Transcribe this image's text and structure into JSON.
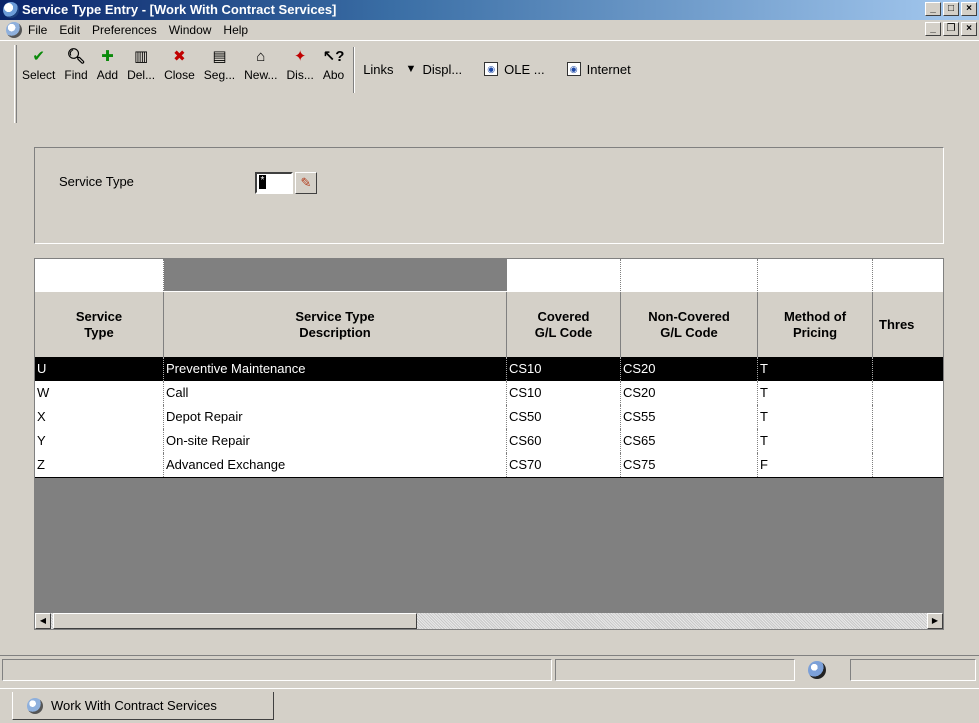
{
  "window": {
    "title_app": "Service Type Entry",
    "title_form": " - [Work With Contract Services]"
  },
  "menu": [
    "File",
    "Edit",
    "Preferences",
    "Window",
    "Help"
  ],
  "toolbar": {
    "buttons": [
      {
        "label": "Select",
        "icon": "check-icon",
        "color": "#0a8a0a"
      },
      {
        "label": "Find",
        "icon": "find-icon",
        "color": "#000000"
      },
      {
        "label": "Add",
        "icon": "plus-icon",
        "color": "#0a8a0a"
      },
      {
        "label": "Del...",
        "icon": "trash-icon",
        "color": "#000000"
      },
      {
        "label": "Close",
        "icon": "close-icon",
        "color": "#c00000"
      },
      {
        "label": "Seg...",
        "icon": "sequencing-icon",
        "color": "#000000"
      },
      {
        "label": "New...",
        "icon": "new-icon",
        "color": "#000000"
      },
      {
        "label": "Dis...",
        "icon": "display-icon",
        "color": "#c00000"
      },
      {
        "label": "Abo",
        "icon": "about-icon",
        "color": "#000000"
      }
    ],
    "links_label": "Links",
    "displ_label": "Displ...",
    "ole_label": "OLE ...",
    "internet_label": "Internet"
  },
  "header": {
    "service_type_label": "Service Type",
    "service_type_value": "*"
  },
  "grid": {
    "columns": [
      {
        "line1": "Service",
        "line2": "Type"
      },
      {
        "line1": "Service Type",
        "line2": "Description"
      },
      {
        "line1": "Covered",
        "line2": "G/L Code"
      },
      {
        "line1": "Non-Covered",
        "line2": "G/L Code"
      },
      {
        "line1": "Method of",
        "line2": "Pricing"
      },
      {
        "line1": "Thres",
        "line2": ""
      }
    ],
    "rows": [
      {
        "type": "U",
        "description": "Preventive Maintenance",
        "covered": "CS10",
        "noncovered": "CS20",
        "pricing": "T",
        "selected": true
      },
      {
        "type": "W",
        "description": "Call",
        "covered": "CS10",
        "noncovered": "CS20",
        "pricing": "T",
        "selected": false
      },
      {
        "type": "X",
        "description": "Depot Repair",
        "covered": "CS50",
        "noncovered": "CS55",
        "pricing": "T",
        "selected": false
      },
      {
        "type": "Y",
        "description": "On-site Repair",
        "covered": "CS60",
        "noncovered": "CS65",
        "pricing": "T",
        "selected": false
      },
      {
        "type": "Z",
        "description": "Advanced Exchange",
        "covered": "CS70",
        "noncovered": "CS75",
        "pricing": "F",
        "selected": false
      }
    ]
  },
  "tabs": [
    {
      "label": "Work With Contract Services"
    }
  ]
}
